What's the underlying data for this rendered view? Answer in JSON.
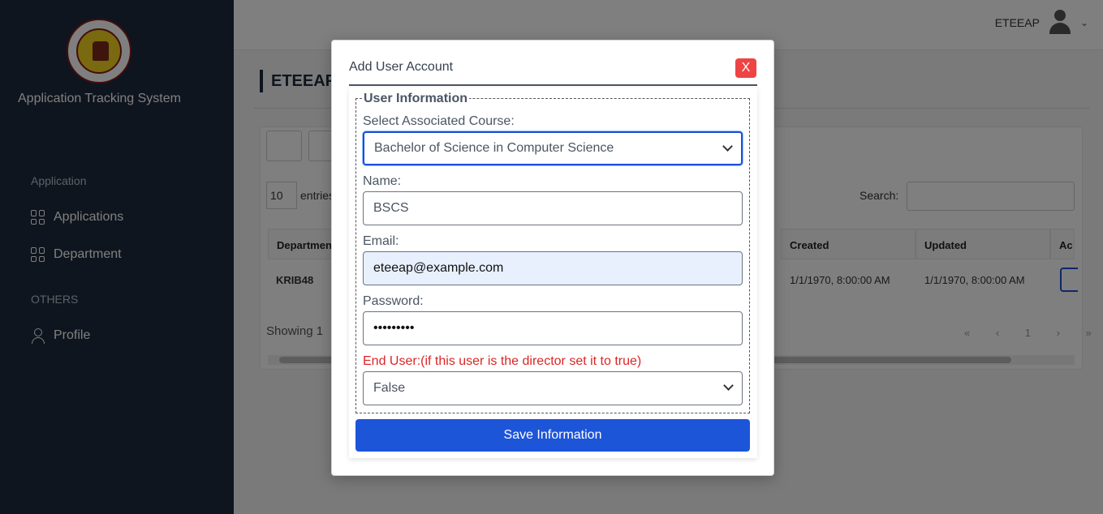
{
  "sidebar": {
    "logo_text": "ARELLANO UNIVERSITY MANILA 1938",
    "title": "Application Tracking System",
    "sections": [
      {
        "label": "Application",
        "items": [
          {
            "label": "Applications",
            "icon": "grid-icon"
          },
          {
            "label": "Department",
            "icon": "grid-icon"
          }
        ]
      },
      {
        "label": "OTHERS",
        "items": [
          {
            "label": "Profile",
            "icon": "user-icon"
          }
        ]
      }
    ]
  },
  "header": {
    "username": "ETEEAP"
  },
  "main": {
    "page_title": "ETEEAP",
    "entries_value": "10",
    "entries_label": "entries",
    "search_label": "Search:",
    "columns": [
      "Department",
      "Created",
      "Updated",
      "Ac"
    ],
    "row": {
      "department": "KRIB48",
      "created": "1/1/1970, 8:00:00 AM",
      "updated": "1/1/1970, 8:00:00 AM"
    },
    "showing_text": "Showing 1",
    "pager": "« ‹ 1 › »"
  },
  "modal": {
    "title": "Add User Account",
    "close_label": "X",
    "legend": "User Information",
    "course_label": "Select Associated Course:",
    "course_value": "Bachelor of Science in Computer Science",
    "name_label": "Name:",
    "name_value": "BSCS",
    "email_label": "Email:",
    "email_value": "eteeap@example.com",
    "password_label": "Password:",
    "password_value": "•••••••••",
    "end_user_label": "End User:(if this user is the director set it to true)",
    "end_user_value": "False",
    "save_label": "Save Information"
  },
  "colors": {
    "sidebar_bg": "#1f2a3c",
    "save_button": "#1d55d9",
    "close_button": "#ef4444",
    "warning_text": "#dc2626",
    "focus_border": "#1d4ed8"
  }
}
